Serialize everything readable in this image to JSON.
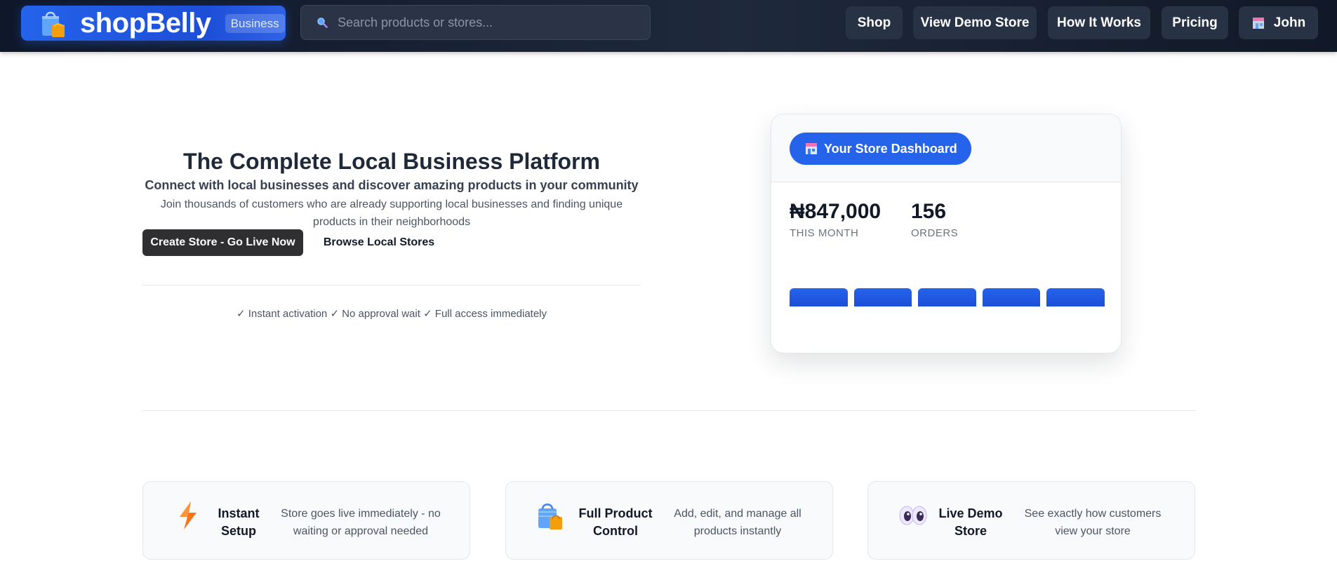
{
  "nav": {
    "brand_name": "shopBelly",
    "brand_badge": "Business",
    "search_placeholder": "Search products or stores...",
    "links": [
      "Shop",
      "View Demo Store",
      "How It Works",
      "Pricing"
    ],
    "user_name": "John"
  },
  "hero": {
    "title": "The Complete Local Business Platform",
    "subtitle": "Connect with local businesses and discover amazing products in your community",
    "description": "Join thousands of customers who are already supporting local businesses and finding unique products in their neighborhoods",
    "primary_cta": "Create Store - Go Live Now",
    "secondary_cta": "Browse Local Stores",
    "perks": "✓ Instant activation ✓ No approval wait ✓ Full access immediately"
  },
  "dashboard": {
    "label": "Your Store Dashboard",
    "revenue_value": "₦847,000",
    "revenue_label": "THIS MONTH",
    "orders_value": "156",
    "orders_label": "ORDERS",
    "bar_levels": [
      0.35,
      0.35,
      0.35,
      0.35,
      0.35
    ]
  },
  "features": [
    {
      "title": "Instant Setup",
      "description": "Store goes live immediately - no waiting or approval needed",
      "icon": "lightning-icon"
    },
    {
      "title": "Full Product Control",
      "description": "Add, edit, and manage all products instantly",
      "icon": "shopping-bag-icon"
    },
    {
      "title": "Live Demo Store",
      "description": "See exactly how customers view your store",
      "icon": "eyes-icon"
    }
  ],
  "colors": {
    "nav_bg": "#0f172a",
    "accent": "#2563eb",
    "dark_button": "#2f2f31"
  }
}
